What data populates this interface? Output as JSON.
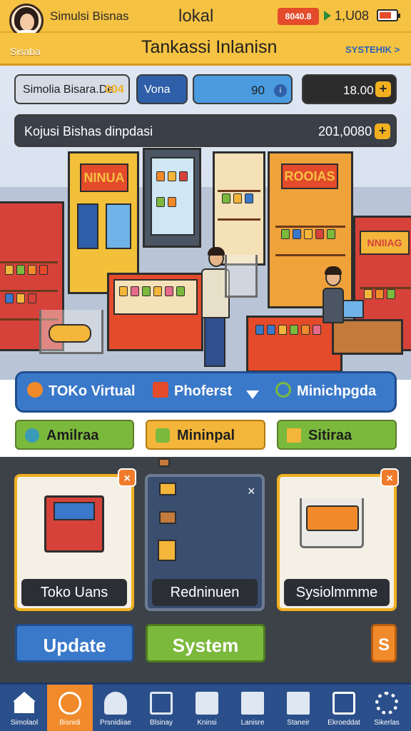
{
  "header": {
    "app_title": "Simulsi Bisnas",
    "center_title": "lokal",
    "coin_badge": "8040.8",
    "time": "1,U08",
    "player_name": "Sisaba",
    "screen_title": "Tankassi Inlanisn",
    "top_link": "SYSTEHIK >"
  },
  "stats": {
    "a_label": "Simolia Bisara.De",
    "a_value": "004",
    "b_label": "Vona",
    "c_value": "90",
    "d_value": "18.00",
    "e_label": "Kojusi Bishas dinpdasi",
    "e_value": "201,0080"
  },
  "booth_signs": {
    "left": "NINUA",
    "right": "ROOIAS",
    "far_right": "NNIIAG"
  },
  "tabs": [
    {
      "label": "TOKo Virtual"
    },
    {
      "label": "Phoferst"
    },
    {
      "label": "Minichpgda"
    }
  ],
  "categories": [
    {
      "label": "Amilraa"
    },
    {
      "label": "Mininpal"
    },
    {
      "label": "Sitiraa"
    }
  ],
  "cards": [
    {
      "caption": "Toko Uans",
      "close": "×"
    },
    {
      "caption": "Redninuen",
      "close": "×"
    },
    {
      "caption": "Sysiolmmme",
      "close": "×"
    }
  ],
  "actions": {
    "update": "Update",
    "system": "System",
    "extra": "S"
  },
  "nav": [
    {
      "label": "Simolaol",
      "icon": "home-icon"
    },
    {
      "label": "Bisnidi",
      "icon": "dashboard-icon"
    },
    {
      "label": "Prsnidiiae",
      "icon": "helmet-icon"
    },
    {
      "label": "Blsinay",
      "icon": "basket-icon"
    },
    {
      "label": "Kninsi",
      "icon": "box-icon"
    },
    {
      "label": "Lanisre",
      "icon": "truck-icon"
    },
    {
      "label": "Staneir",
      "icon": "crate-icon"
    },
    {
      "label": "Ekroeddat",
      "icon": "store-icon"
    },
    {
      "label": "Sikerlas",
      "icon": "gear-icon"
    }
  ],
  "colors": {
    "header": "#f6c242",
    "primary_blue": "#3a78c9",
    "green": "#7bb93c",
    "orange": "#f08a2a",
    "dark_panel": "#3d4248",
    "nav": "#2a4f8a"
  }
}
